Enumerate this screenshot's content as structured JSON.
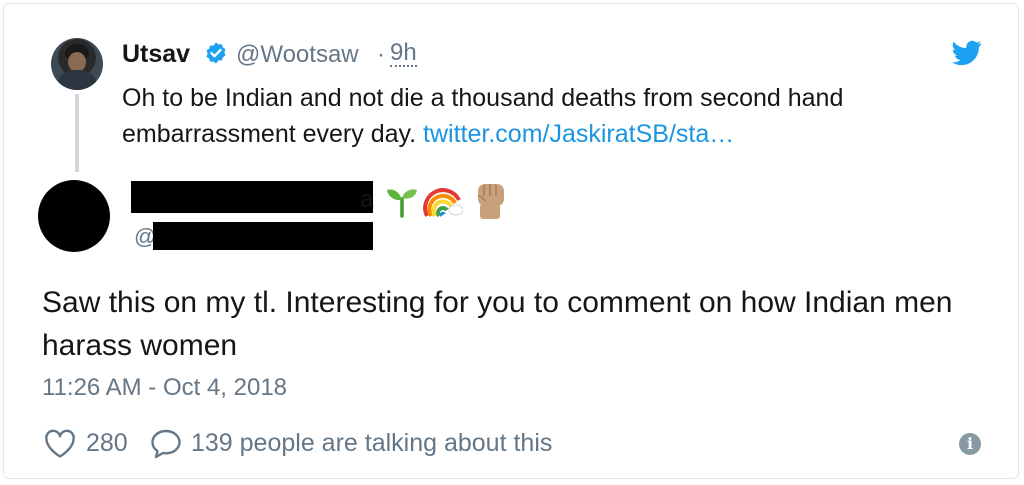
{
  "parent_tweet": {
    "author_name": "Utsav",
    "handle": "@Wootsaw",
    "separator": "·",
    "time_ago": "9h",
    "text": "Oh to be Indian and not die a thousand deaths from second hand embarrassment every day. ",
    "link_text": "twitter.com/JaskiratSB/sta…",
    "avatar_icon": "user-photo-avatar",
    "verified_icon": "verified-badge-icon",
    "brand_icon": "twitter-bird-icon"
  },
  "reply_tweet": {
    "name_tail": "a",
    "emojis": [
      "seedling-emoji",
      "rainbow-emoji",
      "raised-fist-emoji"
    ],
    "handle_prefix": "@",
    "text": "Saw this on my tl. Interesting for you to comment on how Indian men harass women",
    "timestamp": "11:26 AM - Oct 4, 2018"
  },
  "actions": {
    "like_count": "280",
    "talking_text": "139 people are talking about this",
    "info_label": "i"
  },
  "colors": {
    "link": "#1b95e0",
    "muted": "#657786",
    "text": "#14171a",
    "verified": "#1da1f2",
    "border": "#e1e8ed"
  }
}
